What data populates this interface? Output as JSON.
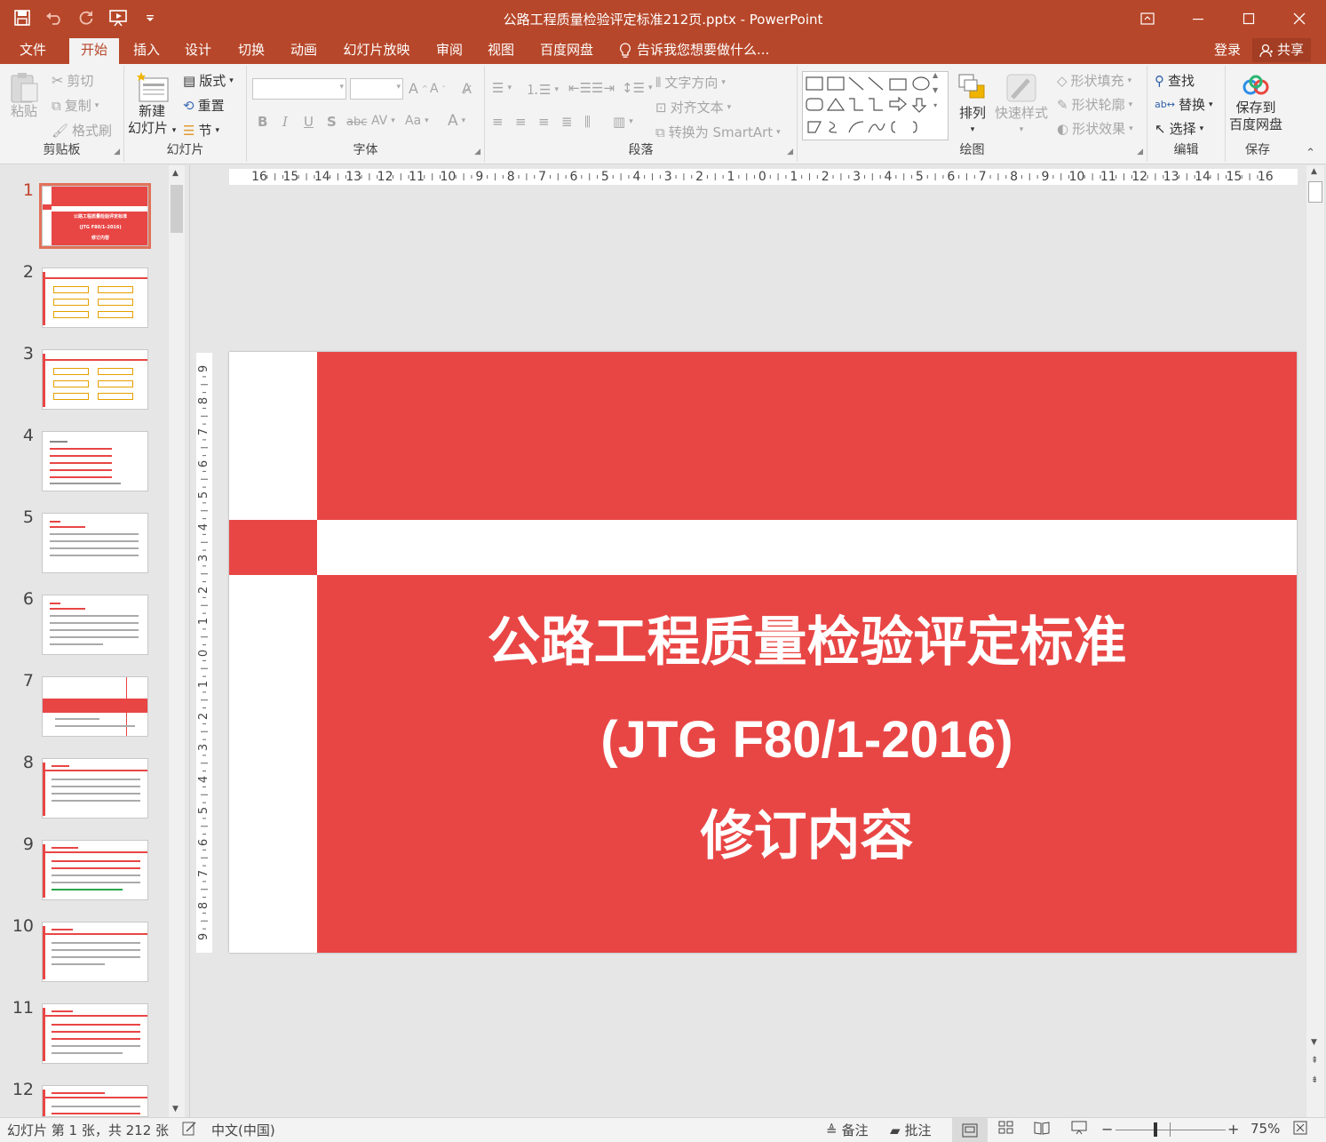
{
  "window": {
    "title": "公路工程质量检验评定标准212页.pptx - PowerPoint"
  },
  "tabs": [
    {
      "label": "文件"
    },
    {
      "label": "开始"
    },
    {
      "label": "插入"
    },
    {
      "label": "设计"
    },
    {
      "label": "切换"
    },
    {
      "label": "动画"
    },
    {
      "label": "幻灯片放映"
    },
    {
      "label": "审阅"
    },
    {
      "label": "视图"
    },
    {
      "label": "百度网盘"
    }
  ],
  "tell_me": "告诉我您想要做什么...",
  "account": {
    "login": "登录",
    "share": "共享"
  },
  "ribbon": {
    "clipboard": {
      "paste": "粘贴",
      "cut": "剪切",
      "copy": "复制",
      "format_painter": "格式刷",
      "label": "剪贴板"
    },
    "slides": {
      "new_slide_1": "新建",
      "new_slide_2": "幻灯片",
      "layout": "版式",
      "reset": "重置",
      "section": "节",
      "label": "幻灯片"
    },
    "font": {
      "label": "字体",
      "bold": "B",
      "italic": "I",
      "underline": "U",
      "shadow": "S",
      "strike": "abc",
      "spacing": "AV",
      "case": "Aa"
    },
    "paragraph": {
      "text_direction": "文字方向",
      "align_text": "对齐文本",
      "smartart": "转换为 SmartArt",
      "label": "段落"
    },
    "drawing": {
      "arrange": "排列",
      "quick_styles": "快速样式",
      "shape_fill": "形状填充",
      "shape_outline": "形状轮廓",
      "shape_effects": "形状效果",
      "label": "绘图"
    },
    "editing": {
      "find": "查找",
      "replace": "替换",
      "select": "选择",
      "label": "编辑"
    },
    "save": {
      "save_to_1": "保存到",
      "save_to_2": "百度网盘",
      "label": "保存"
    }
  },
  "ruler": {
    "horizontal": [
      "16",
      "15",
      "14",
      "13",
      "12",
      "11",
      "10",
      "9",
      "8",
      "7",
      "6",
      "5",
      "4",
      "3",
      "2",
      "1",
      "0",
      "1",
      "2",
      "3",
      "4",
      "5",
      "6",
      "7",
      "8",
      "9",
      "10",
      "11",
      "12",
      "13",
      "14",
      "15",
      "16"
    ],
    "vertical": [
      "9",
      "8",
      "7",
      "6",
      "5",
      "4",
      "3",
      "2",
      "1",
      "0",
      "1",
      "2",
      "3",
      "4",
      "5",
      "6",
      "7",
      "8",
      "9"
    ]
  },
  "thumbnails": [
    {
      "num": "1",
      "title_line1": "公路工程质量检验评定标准",
      "title_line2": "(JTG F80/1-2016)",
      "title_line3": "修订内容"
    },
    {
      "num": "2"
    },
    {
      "num": "3"
    },
    {
      "num": "4"
    },
    {
      "num": "5"
    },
    {
      "num": "6"
    },
    {
      "num": "7"
    },
    {
      "num": "8"
    },
    {
      "num": "9"
    },
    {
      "num": "10"
    },
    {
      "num": "11"
    },
    {
      "num": "12"
    }
  ],
  "slide": {
    "line1": "公路工程质量检验评定标准",
    "line2": "(JTG F80/1-2016)",
    "line3": "修订内容",
    "accent_color": "#e84645"
  },
  "status": {
    "slide_info": "幻灯片 第 1 张，共 212 张",
    "language": "中文(中国)",
    "notes": "备注",
    "comments": "批注",
    "zoom": "75%",
    "zoom_level": 0.75
  },
  "colors": {
    "titlebar": "#b7472a",
    "slide_red": "#e84645"
  }
}
